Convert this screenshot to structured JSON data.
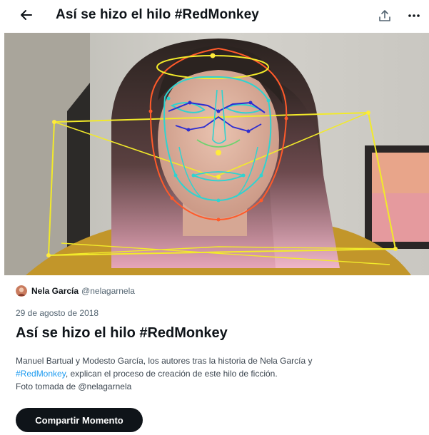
{
  "header": {
    "title": "Así se hizo el hilo #RedMonkey",
    "back_icon": "arrow-left-icon",
    "share_icon": "share-upload-icon",
    "more_icon": "more-dots-icon"
  },
  "media": {
    "overlay_colors": {
      "outline": "#ff5a2a",
      "contour": "#2fd3d0",
      "brows_nose": "#2d2dd1",
      "inner": "#6fd26f",
      "box": "#f2ea2a",
      "points": "#ffeb3b"
    }
  },
  "author": {
    "name": "Nela García",
    "handle": "@nelagarnela",
    "avatar_icon": "avatar"
  },
  "moment": {
    "date": "29 de agosto de 2018",
    "title": "Así se hizo el hilo #RedMonkey",
    "desc_part1": "Manuel Bartual y Modesto García, los autores tras la historia de Nela García y",
    "hashtag": "#RedMonkey",
    "desc_part2": ", explican el proceso de creación de este hilo de ficción.",
    "credit": "Foto tomada de @nelagarnela"
  },
  "actions": {
    "share_moment_label": "Compartir Momento"
  },
  "colors": {
    "accent": "#1d9bf0",
    "text": "#0f1419",
    "muted": "#536471",
    "button_bg": "#0f1419"
  }
}
